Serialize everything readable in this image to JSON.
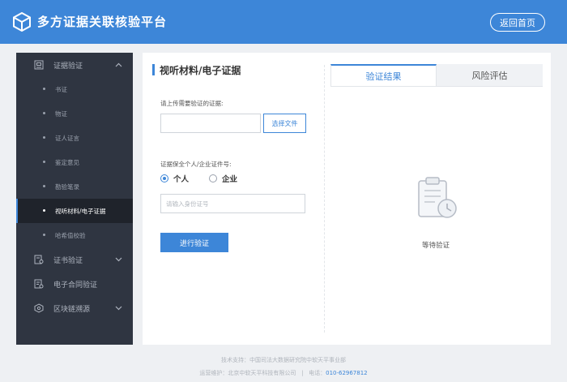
{
  "header": {
    "app_title": "多方证据关联核验平台",
    "home_button": "返回首页",
    "logo_icon": "cube-icon"
  },
  "sidebar": {
    "groups": [
      {
        "label": "证据验证",
        "icon": "evidence-icon",
        "expanded": true
      },
      {
        "label": "证书验证",
        "icon": "certificate-icon",
        "expanded": false
      },
      {
        "label": "电子合同验证",
        "icon": "contract-icon"
      },
      {
        "label": "区块链溯源",
        "icon": "blockchain-icon",
        "expanded": false
      }
    ],
    "sub_items": [
      {
        "label": "书证"
      },
      {
        "label": "物证"
      },
      {
        "label": "证人证言"
      },
      {
        "label": "鉴定意见"
      },
      {
        "label": "勘验笔录"
      },
      {
        "label": "视听材料/电子证据",
        "active": true
      },
      {
        "label": "哈希值校验"
      }
    ]
  },
  "form": {
    "section_title": "视听材料/电子证据",
    "upload_label": "请上传需要验证的证据:",
    "select_file_button": "选择文件",
    "id_type_label": "证据保全个人/企业证件号:",
    "radio_options": [
      {
        "label": "个人",
        "checked": true
      },
      {
        "label": "企业",
        "checked": false
      }
    ],
    "id_placeholder": "请输入身份证号",
    "verify_button": "进行验证"
  },
  "result_panel": {
    "tabs": [
      {
        "label": "验证结果",
        "active": true
      },
      {
        "label": "风险评估",
        "active": false
      }
    ],
    "empty_icon": "clipboard-clock-icon",
    "empty_text": "等待验证"
  },
  "footer": {
    "support": "技术支持：中国司法大数据研究院中软天平事业部",
    "ops": "运营维护：北京中软天平科技有限公司",
    "separator": "|",
    "phone_label": "电话：",
    "phone": "010-62967812"
  },
  "colors": {
    "brand": "#3d86d8",
    "sidebar_bg": "#2f3541",
    "sidebar_active": "#1f232b"
  }
}
